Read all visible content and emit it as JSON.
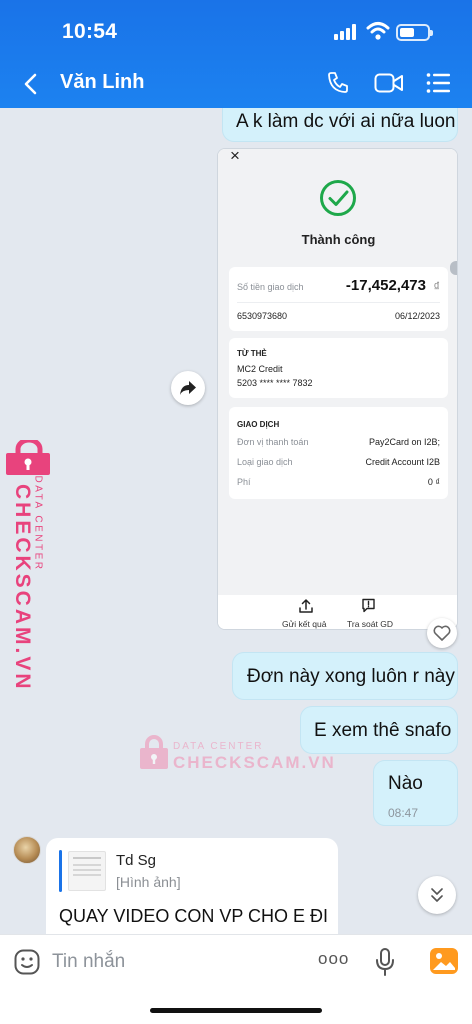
{
  "status": {
    "time": "10:54"
  },
  "header": {
    "contact_name": "Văn Linh"
  },
  "messages": {
    "m1": "A k làm dc với ai nữa luon",
    "m2": "Đơn này xong luôn r này",
    "m3": "E xem thê snafo",
    "m4": "Nào",
    "m4_time": "08:47",
    "reply": {
      "sender": "Td Sg",
      "quoted": "[Hình ảnh]",
      "text": "QUAY VIDEO CON VP CHO E ĐI"
    }
  },
  "receipt": {
    "close": "×",
    "status": "Thành công",
    "amount_label": "Số tiền giao dịch",
    "amount": "-17,452,473",
    "currency": "₫",
    "ref": "6530973680",
    "date": "06/12/2023",
    "from_title": "TỪ THẺ",
    "card_name": "MC2 Credit",
    "card_number": "5203 **** **** 7832",
    "txn_title": "GIAO DỊCH",
    "rows": [
      {
        "label": "Đơn vị thanh toán",
        "value": "Pay2Card on I2B;"
      },
      {
        "label": "Loại giao dịch",
        "value": "Credit Account I2B"
      },
      {
        "label": "Phí",
        "value": "0 ₫"
      }
    ],
    "btn_send": "Gửi kết quả",
    "btn_check": "Tra soát GD"
  },
  "watermark": {
    "top": "DATA CENTER",
    "brand": "CHECKSCAM.VN"
  },
  "composer": {
    "placeholder": "Tin nhắn",
    "more": "ooo"
  },
  "colors": {
    "header": "#1a73e8",
    "bubble": "#d4f1fb",
    "success": "#1ea84a",
    "watermark": "#e8437d"
  }
}
